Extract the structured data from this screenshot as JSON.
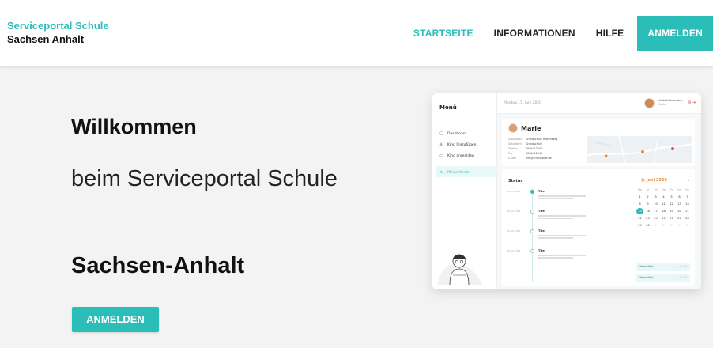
{
  "header": {
    "brand_line1": "Serviceportal Schule",
    "brand_line2": "Sachsen Anhalt",
    "nav": [
      {
        "label": "STARTSEITE",
        "active": true
      },
      {
        "label": "INFORMATIONEN",
        "active": false
      },
      {
        "label": "HILFE",
        "active": false
      }
    ],
    "cta_label": "ANMELDEN",
    "accent_color": "#2bbdb7"
  },
  "hero": {
    "title": "Willkommen",
    "subtitle": "beim Serviceportal Schule",
    "region": "Sachsen-Anhalt",
    "button_label": "ANMELDEN"
  },
  "mockup": {
    "menu_title": "Menü",
    "menu_items": [
      {
        "label": "Dashboard",
        "icon": "dashboard-icon",
        "active": false
      },
      {
        "label": "Kind hinzufügen",
        "icon": "add-user-icon",
        "active": false
      },
      {
        "label": "Kind anmelden",
        "icon": "id-card-icon",
        "active": false
      },
      {
        "label": "Meine Kinder",
        "icon": "children-icon",
        "active": true
      }
    ],
    "date": "Montag 15. Juni 2020",
    "user_name": "Linda Heinemann",
    "user_role": "Mutter",
    "child_name": "Marie",
    "child_info": [
      {
        "label": "Schulname",
        "value": "Grundschule Wittenberg"
      },
      {
        "label": "Schulform",
        "value": "Grundschule"
      },
      {
        "label": "Telefon",
        "value": "0000/ 12345"
      },
      {
        "label": "Fax",
        "value": "0000/ 12345"
      },
      {
        "label": "E-Mail",
        "value": "info@schulname.de"
      }
    ],
    "status_title": "Status",
    "status_items": [
      {
        "time": "00.00.2020",
        "title": "Titel",
        "active": true
      },
      {
        "time": "00.00.2020",
        "title": "Titel",
        "active": false
      },
      {
        "time": "00.00.2020",
        "title": "Titel",
        "active": false
      },
      {
        "time": "00.00.2020",
        "title": "Titel",
        "active": false
      }
    ],
    "calendar_title": "Juni 2020",
    "weekdays": [
      "Mo",
      "Di",
      "Mi",
      "Do",
      "Fr",
      "Sa",
      "So"
    ],
    "calendar_rows": [
      [
        "1",
        "2",
        "3",
        "4",
        "5",
        "6",
        "7"
      ],
      [
        "8",
        "9",
        "10",
        "11",
        "12",
        "13",
        "14"
      ],
      [
        "15",
        "16",
        "17",
        "18",
        "19",
        "20",
        "21"
      ],
      [
        "22",
        "23",
        "24",
        "25",
        "26",
        "27",
        "28"
      ],
      [
        "29",
        "30",
        "1",
        "2",
        "3",
        "4",
        "5"
      ]
    ],
    "selected_day": "15",
    "appointments": [
      {
        "label": "Termintitel",
        "time": "00:00"
      },
      {
        "label": "Termintitel",
        "time": "00:00"
      }
    ]
  }
}
